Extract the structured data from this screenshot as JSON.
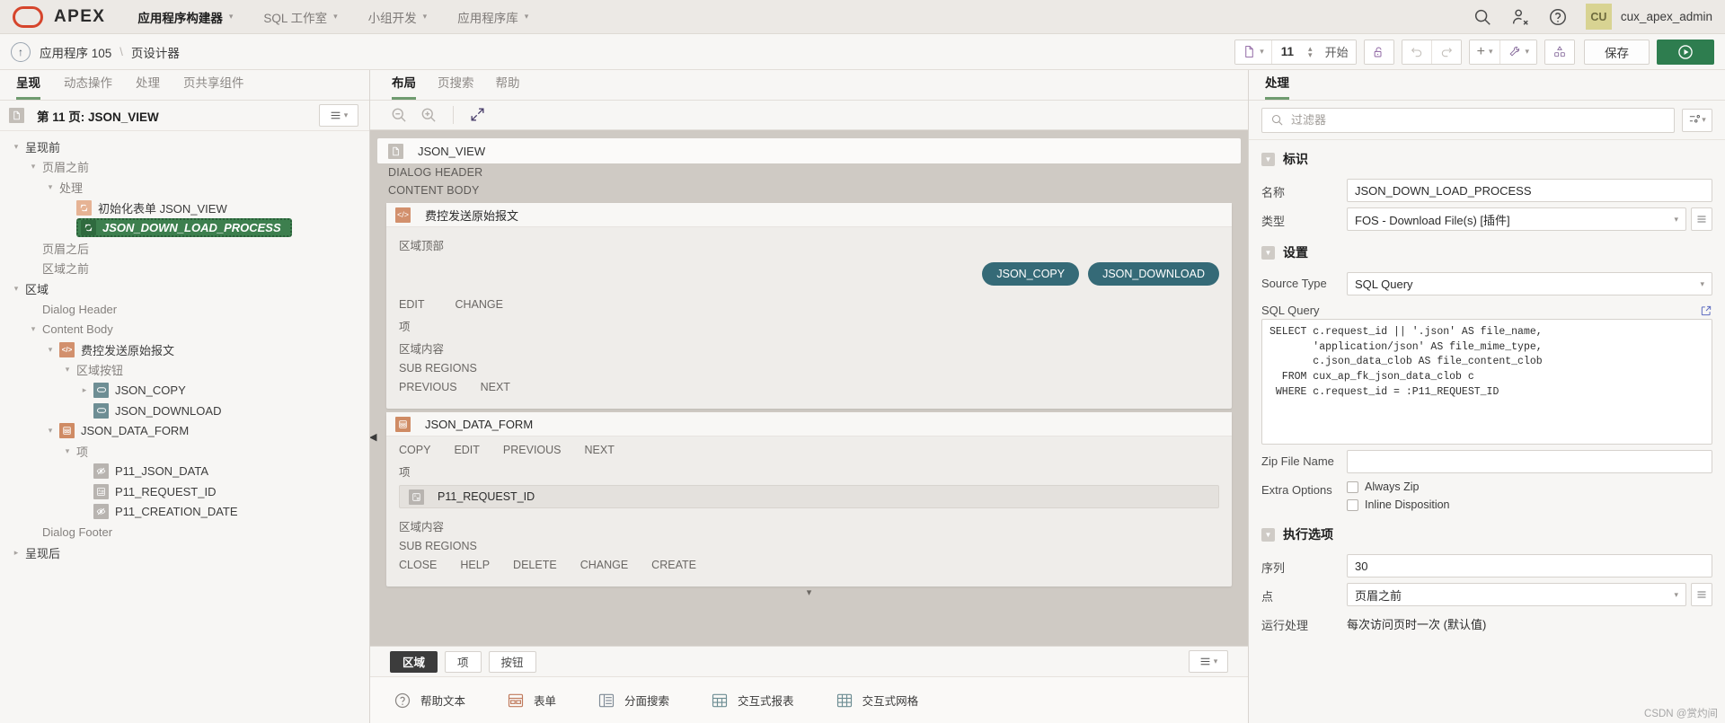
{
  "topnav": {
    "brand": "APEX",
    "items": [
      {
        "label": "应用程序构建器",
        "active": true
      },
      {
        "label": "SQL 工作室",
        "active": false
      },
      {
        "label": "小组开发",
        "active": false
      },
      {
        "label": "应用程序库",
        "active": false
      }
    ],
    "username": "cux_apex_admin",
    "avatar_initials": "CU",
    "icons": [
      "search-icon",
      "user-admin-icon",
      "help-icon"
    ]
  },
  "breadcrumb": {
    "app": "应用程序 105",
    "separator": "\\",
    "page": "页设计器",
    "page_number": "11",
    "start_label": "开始",
    "save_label": "保存"
  },
  "left": {
    "tabs": [
      {
        "label": "呈现",
        "active": true
      },
      {
        "label": "动态操作",
        "active": false
      },
      {
        "label": "处理",
        "active": false
      },
      {
        "label": "页共享组件",
        "active": false
      }
    ],
    "tree_title": "第 11 页: JSON_VIEW",
    "nodes": [
      {
        "label": "呈现前",
        "indent": 0,
        "twisty": "down",
        "icon": "",
        "muted": false
      },
      {
        "label": "页眉之前",
        "indent": 1,
        "twisty": "down",
        "icon": "",
        "muted": true
      },
      {
        "label": "处理",
        "indent": 2,
        "twisty": "down",
        "icon": "",
        "muted": true
      },
      {
        "label": "初始化表单 JSON_VIEW",
        "indent": 3,
        "twisty": "",
        "icon": "process-icon",
        "muted": false
      },
      {
        "label": "JSON_DOWN_LOAD_PROCESS",
        "indent": 3,
        "twisty": "",
        "icon": "process-icon",
        "muted": false,
        "selected": true
      },
      {
        "label": "页眉之后",
        "indent": 1,
        "twisty": "",
        "icon": "",
        "muted": true
      },
      {
        "label": "区域之前",
        "indent": 1,
        "twisty": "",
        "icon": "",
        "muted": true
      },
      {
        "label": "区域",
        "indent": 0,
        "twisty": "down",
        "icon": "",
        "muted": false
      },
      {
        "label": "Dialog Header",
        "indent": 1,
        "twisty": "",
        "icon": "",
        "muted": true
      },
      {
        "label": "Content Body",
        "indent": 1,
        "twisty": "down",
        "icon": "",
        "muted": true
      },
      {
        "label": "费控发送原始报文",
        "indent": 2,
        "twisty": "down",
        "icon": "code-icon",
        "muted": false
      },
      {
        "label": "区域按钮",
        "indent": 3,
        "twisty": "down",
        "icon": "",
        "muted": true
      },
      {
        "label": "JSON_COPY",
        "indent": 4,
        "twisty": "right",
        "icon": "button-icon",
        "muted": false
      },
      {
        "label": "JSON_DOWNLOAD",
        "indent": 4,
        "twisty": "",
        "icon": "button-icon",
        "muted": false
      },
      {
        "label": "JSON_DATA_FORM",
        "indent": 2,
        "twisty": "down",
        "icon": "form-icon",
        "muted": false
      },
      {
        "label": "项",
        "indent": 3,
        "twisty": "down",
        "icon": "",
        "muted": true
      },
      {
        "label": "P11_JSON_DATA",
        "indent": 4,
        "twisty": "",
        "icon": "hidden-item-icon",
        "muted": false
      },
      {
        "label": "P11_REQUEST_ID",
        "indent": 4,
        "twisty": "",
        "icon": "text-item-icon",
        "muted": false
      },
      {
        "label": "P11_CREATION_DATE",
        "indent": 4,
        "twisty": "",
        "icon": "hidden-item-icon",
        "muted": false
      },
      {
        "label": "Dialog Footer",
        "indent": 1,
        "twisty": "",
        "icon": "",
        "muted": true
      },
      {
        "label": "呈现后",
        "indent": 0,
        "twisty": "right",
        "icon": "",
        "muted": false
      }
    ]
  },
  "center": {
    "tabs": [
      {
        "label": "布局",
        "active": true
      },
      {
        "label": "页搜索",
        "active": false
      },
      {
        "label": "帮助",
        "active": false
      }
    ],
    "page_card_title": "JSON_VIEW",
    "zone_dialog_header": "DIALOG HEADER",
    "zone_content_body": "CONTENT BODY",
    "region1": {
      "title": "费控发送原始报文",
      "top_label": "区域顶部",
      "buttons": [
        "JSON_COPY",
        "JSON_DOWNLOAD"
      ],
      "positions_1": [
        "EDIT",
        "CHANGE"
      ],
      "items_label": "项",
      "content_label": "区域内容",
      "sub_regions_label": "SUB REGIONS",
      "positions_2": [
        "PREVIOUS",
        "NEXT"
      ]
    },
    "region2": {
      "title": "JSON_DATA_FORM",
      "positions_1": [
        "COPY",
        "EDIT",
        "PREVIOUS",
        "NEXT"
      ],
      "items_label": "项",
      "item_chip": "P11_REQUEST_ID",
      "content_label": "区域内容",
      "sub_regions_label": "SUB REGIONS",
      "positions_2": [
        "CLOSE",
        "HELP",
        "DELETE",
        "CHANGE",
        "CREATE"
      ]
    },
    "gallery_tabs": [
      {
        "label": "区域",
        "active": true
      },
      {
        "label": "项",
        "active": false
      },
      {
        "label": "按钮",
        "active": false
      }
    ],
    "gallery_items": [
      {
        "label": "帮助文本",
        "icon": "help-text-icon"
      },
      {
        "label": "表单",
        "icon": "form-icon"
      },
      {
        "label": "分面搜索",
        "icon": "faceted-search-icon"
      },
      {
        "label": "交互式报表",
        "icon": "interactive-report-icon"
      },
      {
        "label": "交互式网格",
        "icon": "interactive-grid-icon"
      }
    ]
  },
  "right": {
    "tabs": [
      {
        "label": "处理",
        "active": true
      }
    ],
    "filter_placeholder": "过滤器",
    "groups": [
      {
        "title": "标识",
        "rows": [
          {
            "label": "名称",
            "value": "JSON_DOWN_LOAD_PROCESS",
            "type": "text"
          },
          {
            "label": "类型",
            "value": "FOS - Download File(s) [插件]",
            "type": "select-with-button"
          }
        ]
      },
      {
        "title": "设置",
        "rows": [
          {
            "label": "Source Type",
            "value": "SQL Query",
            "type": "select"
          }
        ],
        "sql_label": "SQL Query",
        "sql_value": "SELECT c.request_id || '.json' AS file_name,\n       'application/json' AS file_mime_type,\n       c.json_data_clob AS file_content_clob\n  FROM cux_ap_fk_json_data_clob c\n WHERE c.request_id = :P11_REQUEST_ID",
        "zip_label": "Zip File Name",
        "zip_value": "",
        "extra_label": "Extra Options",
        "extra_options": [
          {
            "label": "Always Zip",
            "checked": false
          },
          {
            "label": "Inline Disposition",
            "checked": false
          }
        ]
      },
      {
        "title": "执行选项",
        "rows": [
          {
            "label": "序列",
            "value": "30",
            "type": "text"
          },
          {
            "label": "点",
            "value": "页眉之前",
            "type": "select-with-button"
          },
          {
            "label": "运行处理",
            "value": "每次访问页时一次 (默认值)",
            "type": "select"
          }
        ]
      }
    ]
  },
  "watermark": "CSDN @赏灼间"
}
